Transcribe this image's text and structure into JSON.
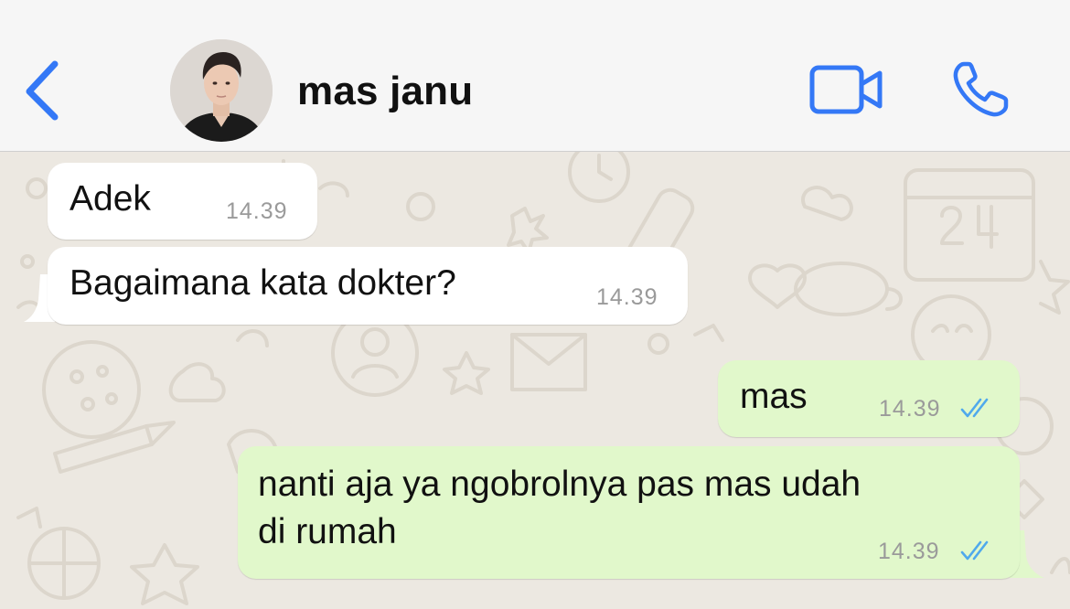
{
  "header": {
    "back_icon": "chevron-left-icon",
    "contact_name": "mas janu",
    "video_icon": "video-camera-icon",
    "call_icon": "phone-icon",
    "accent_color": "#3478f6"
  },
  "messages": [
    {
      "direction": "incoming",
      "text": "Adek",
      "time": "14.39"
    },
    {
      "direction": "incoming",
      "text": "Bagaimana kata dokter?",
      "time": "14.39"
    },
    {
      "direction": "outgoing",
      "text": "mas",
      "time": "14.39",
      "status": "read"
    },
    {
      "direction": "outgoing",
      "text": "nanti aja ya ngobrolnya pas mas udah\ndi rumah",
      "time": "14.39",
      "status": "read"
    }
  ],
  "colors": {
    "incoming_bubble": "#ffffff",
    "outgoing_bubble": "#e1f8cb",
    "read_ticks": "#4fa9ec",
    "wallpaper": "#ece8e1"
  }
}
